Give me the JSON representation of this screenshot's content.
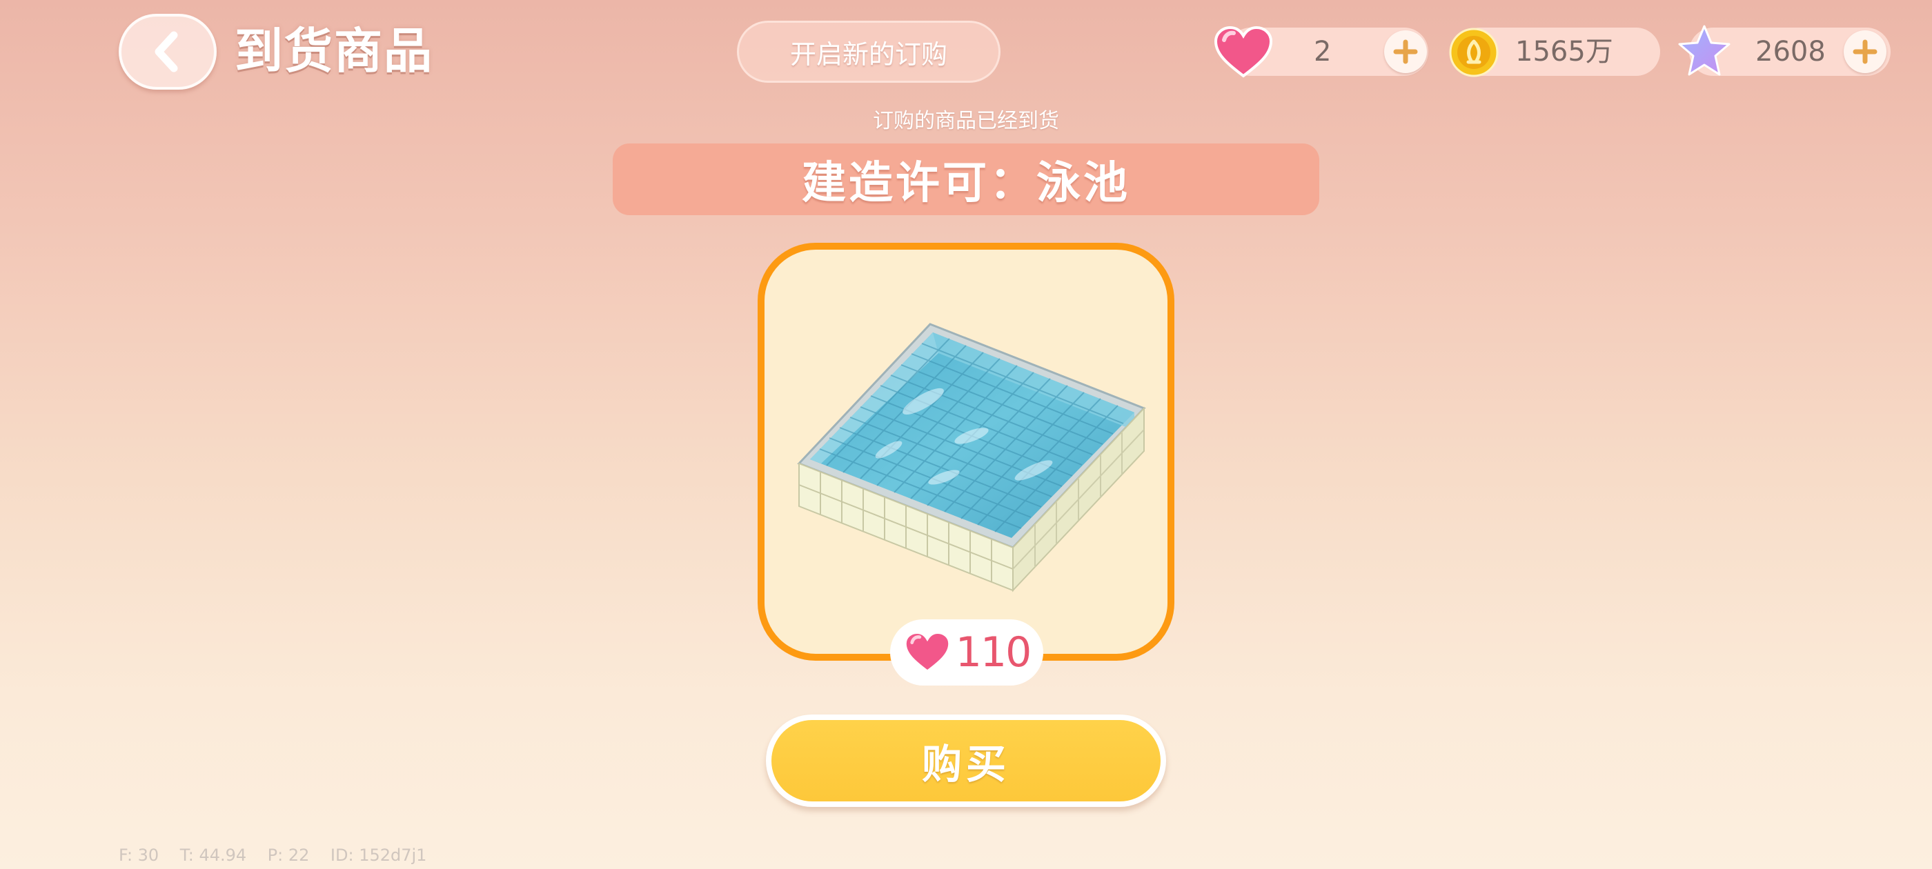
{
  "header": {
    "title": "到货商品",
    "new_order_label": "开启新的订购"
  },
  "resources": {
    "hearts": {
      "value": "2",
      "icon": "pink-heart-icon"
    },
    "coins": {
      "value": "1565万",
      "icon": "gold-coin-icon"
    },
    "stars": {
      "value": "2608",
      "icon": "purple-star-icon"
    }
  },
  "order": {
    "arrived_text": "订购的商品已经到货",
    "item_name": "建造许可：泳池",
    "item_icon": "swimming-pool-illustration",
    "price": "110",
    "price_icon": "pink-heart-icon",
    "buy_label": "购买"
  },
  "debug": {
    "text": "F: 30    T: 44.94    P: 22    ID: 152d7j1"
  },
  "colors": {
    "card_border": "#fd9a12",
    "card_fill": "#fdeecf",
    "banner": "#f5aa95",
    "buy_button": "#fdc83a",
    "price_text": "#e8566e"
  }
}
